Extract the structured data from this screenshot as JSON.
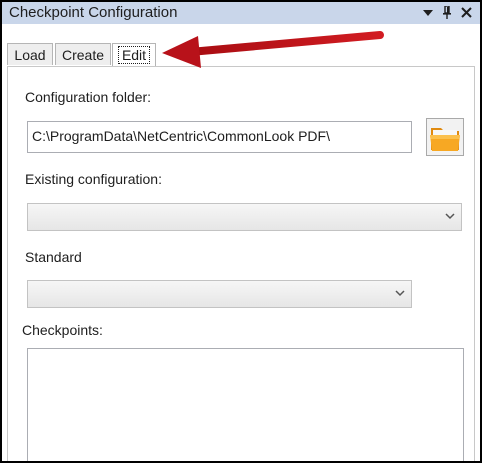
{
  "window": {
    "title": "Checkpoint Configuration",
    "controls": {
      "menu_icon": "dropdown-arrow-icon",
      "pin_icon": "pin-icon",
      "close_icon": "close-icon"
    }
  },
  "tabs": [
    {
      "label": "Load",
      "active": false
    },
    {
      "label": "Create",
      "active": false
    },
    {
      "label": "Edit",
      "active": true
    }
  ],
  "form": {
    "config_folder_label": "Configuration folder:",
    "config_folder_value": "C:\\ProgramData\\NetCentric\\CommonLook PDF\\",
    "browse_icon": "folder-icon",
    "existing_config_label": "Existing configuration:",
    "existing_config_value": "",
    "standard_label": "Standard",
    "standard_value": "",
    "checkpoints_label": "Checkpoints:"
  },
  "annotation": {
    "arrow_color": "#c0151a",
    "points_to": "Edit"
  },
  "colors": {
    "titlebar": "#c9d6ea",
    "frame": "#000000",
    "folder": "#f4a11d"
  }
}
